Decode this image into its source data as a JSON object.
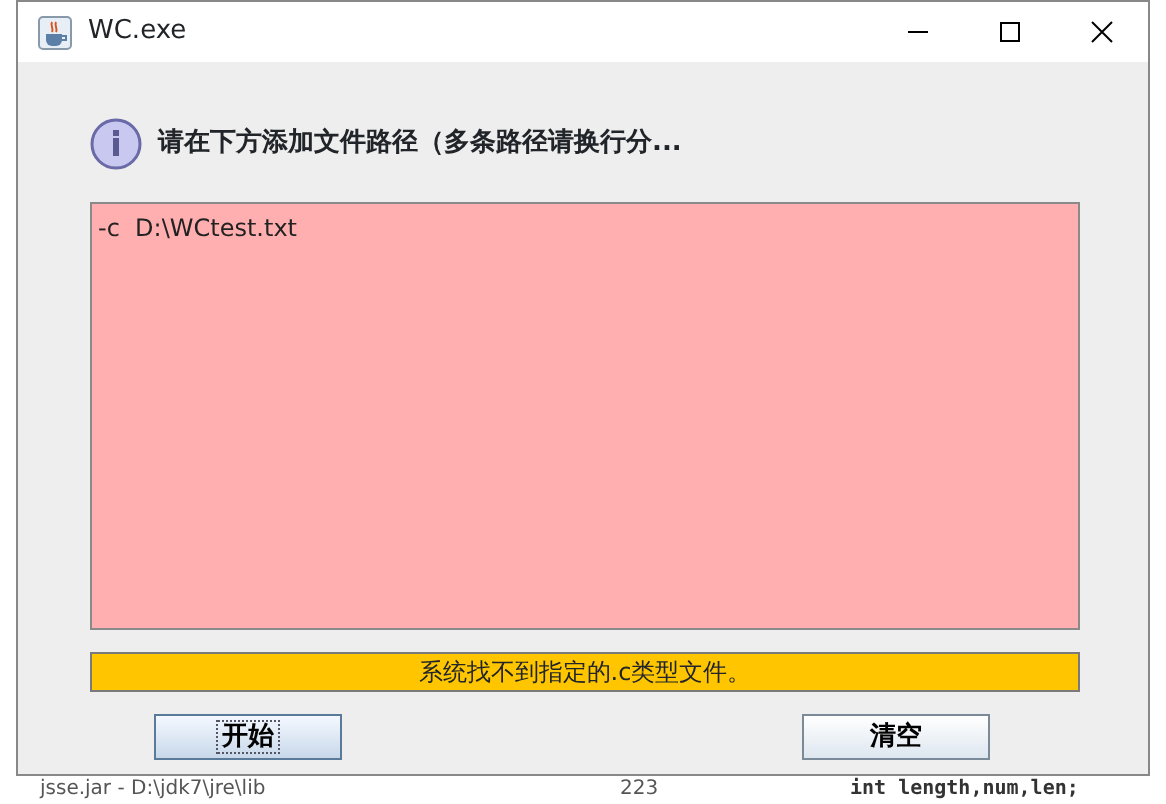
{
  "window": {
    "title": "WC.exe"
  },
  "message": "请在下方添加文件路径（多条路径请换行分...",
  "input": {
    "value": "-c  D:\\WCtest.txt"
  },
  "status": "系统找不到指定的.c类型文件。",
  "buttons": [
    {
      "label": "开始",
      "focused": true
    },
    {
      "label": "清空",
      "focused": false
    }
  ],
  "background": {
    "items": [
      "jsse.jar - D:\\jdk7\\jre\\lib",
      "223",
      "int length,num,len;"
    ]
  }
}
